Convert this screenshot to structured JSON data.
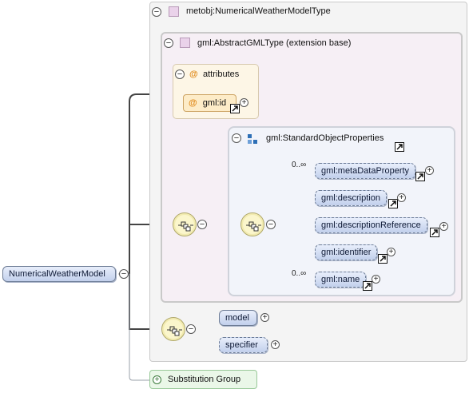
{
  "root": {
    "label": "NumericalWeatherModel",
    "collapse_glyph": "−"
  },
  "type": {
    "label": "metobj:NumericalWeatherModelType",
    "collapse_glyph": "−"
  },
  "base": {
    "label": "gml:AbstractGMLType (extension base)",
    "collapse_glyph": "−"
  },
  "attributes": {
    "header": "attributes",
    "header_symbol": "@",
    "collapse_glyph": "−",
    "items": [
      {
        "symbol": "@",
        "label": "gml:id"
      }
    ]
  },
  "standard_props": {
    "label": "gml:StandardObjectProperties",
    "collapse_glyph": "−",
    "elements": [
      {
        "label": "gml:metaDataProperty",
        "occurrence": "0..∞"
      },
      {
        "label": "gml:description",
        "occurrence": ""
      },
      {
        "label": "gml:descriptionReference",
        "occurrence": ""
      },
      {
        "label": "gml:identifier",
        "occurrence": ""
      },
      {
        "label": "gml:name",
        "occurrence": "0..∞"
      }
    ]
  },
  "own_elements": [
    {
      "label": "model"
    },
    {
      "label": "specifier"
    }
  ],
  "substitution": {
    "label": "Substitution Group",
    "expand_glyph": "+"
  },
  "expand_glyph": "+",
  "colors": {
    "element_fill_top": "#e8eefb",
    "element_fill_bottom": "#c2d0ec",
    "base_panel": "#f6eff5",
    "attributes_panel": "#fdf6e6",
    "properties_panel": "#f2f4fa",
    "substitution_panel": "#eaf7e8"
  },
  "icons": {
    "collapse": "collapse-circle-icon",
    "expand": "expand-circle-icon",
    "link": "arrow-link-icon",
    "sequence": "sequence-compositor-icon",
    "group": "group-icon",
    "complex_type": "complex-type-icon"
  }
}
